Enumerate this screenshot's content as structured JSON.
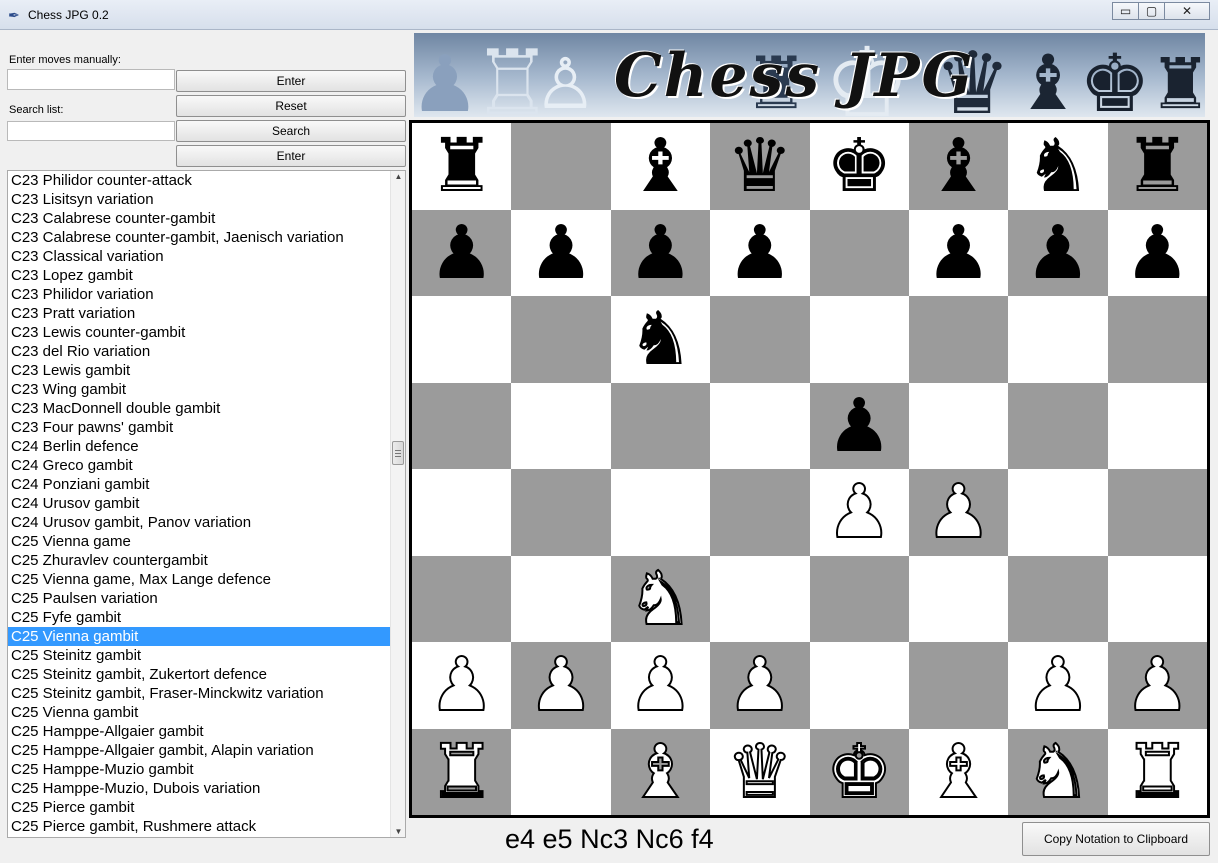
{
  "window": {
    "title": "Chess JPG 0.2",
    "minimize_glyph": "▭",
    "maximize_glyph": "▢",
    "close_glyph": "✕"
  },
  "controls": {
    "manual_label": "Enter moves manually:",
    "manual_value": "",
    "enter_label": "Enter",
    "reset_label": "Reset",
    "search_label": "Search list:",
    "search_value": "",
    "search_button": "Search",
    "enter2_label": "Enter"
  },
  "openings": [
    "C23 Philidor counter-attack",
    "C23 Lisitsyn variation",
    "C23 Calabrese counter-gambit",
    "C23 Calabrese counter-gambit, Jaenisch variation",
    "C23 Classical variation",
    "C23 Lopez gambit",
    "C23 Philidor variation",
    "C23 Pratt variation",
    "C23 Lewis counter-gambit",
    "C23 del Rio variation",
    "C23 Lewis gambit",
    "C23 Wing gambit",
    "C23 MacDonnell double gambit",
    "C23 Four pawns' gambit",
    "C24 Berlin defence",
    "C24 Greco gambit",
    "C24 Ponziani gambit",
    "C24 Urusov gambit",
    "C24 Urusov gambit, Panov variation",
    "C25 Vienna game",
    "C25 Zhuravlev countergambit",
    "C25 Vienna game, Max Lange defence",
    "C25 Paulsen variation",
    "C25 Fyfe gambit",
    "C25 Vienna gambit",
    "C25 Steinitz gambit",
    "C25 Steinitz gambit, Zukertort defence",
    "C25 Steinitz gambit, Fraser-Minckwitz variation",
    "C25 Vienna gambit",
    "C25 Hamppe-Allgaier gambit",
    "C25 Hamppe-Allgaier gambit, Alapin variation",
    "C25 Hamppe-Muzio gambit",
    "C25 Hamppe-Muzio, Dubois variation",
    "C25 Pierce gambit",
    "C25 Pierce gambit, Rushmere attack"
  ],
  "selected_index": 24,
  "banner": {
    "title": "Chess JPG"
  },
  "board": {
    "ranks": [
      [
        "r",
        "",
        "b",
        "q",
        "k",
        "b",
        "n",
        "r"
      ],
      [
        "p",
        "p",
        "p",
        "p",
        "",
        "p",
        "p",
        "p"
      ],
      [
        "",
        "",
        "n",
        "",
        "",
        "",
        "",
        ""
      ],
      [
        "",
        "",
        "",
        "",
        "p",
        "",
        "",
        ""
      ],
      [
        "",
        "",
        "",
        "",
        "P",
        "P",
        "",
        ""
      ],
      [
        "",
        "",
        "N",
        "",
        "",
        "",
        "",
        ""
      ],
      [
        "P",
        "P",
        "P",
        "P",
        "",
        "",
        "P",
        "P"
      ],
      [
        "R",
        "",
        "B",
        "Q",
        "K",
        "B",
        "N",
        "R"
      ]
    ],
    "light_color": "#ffffff",
    "dark_color": "#9b9b9b"
  },
  "notation": "e4 e5 Nc3 Nc6 f4",
  "copy_button": "Copy Notation to Clipboard",
  "colors": {
    "selection": "#3399ff"
  }
}
